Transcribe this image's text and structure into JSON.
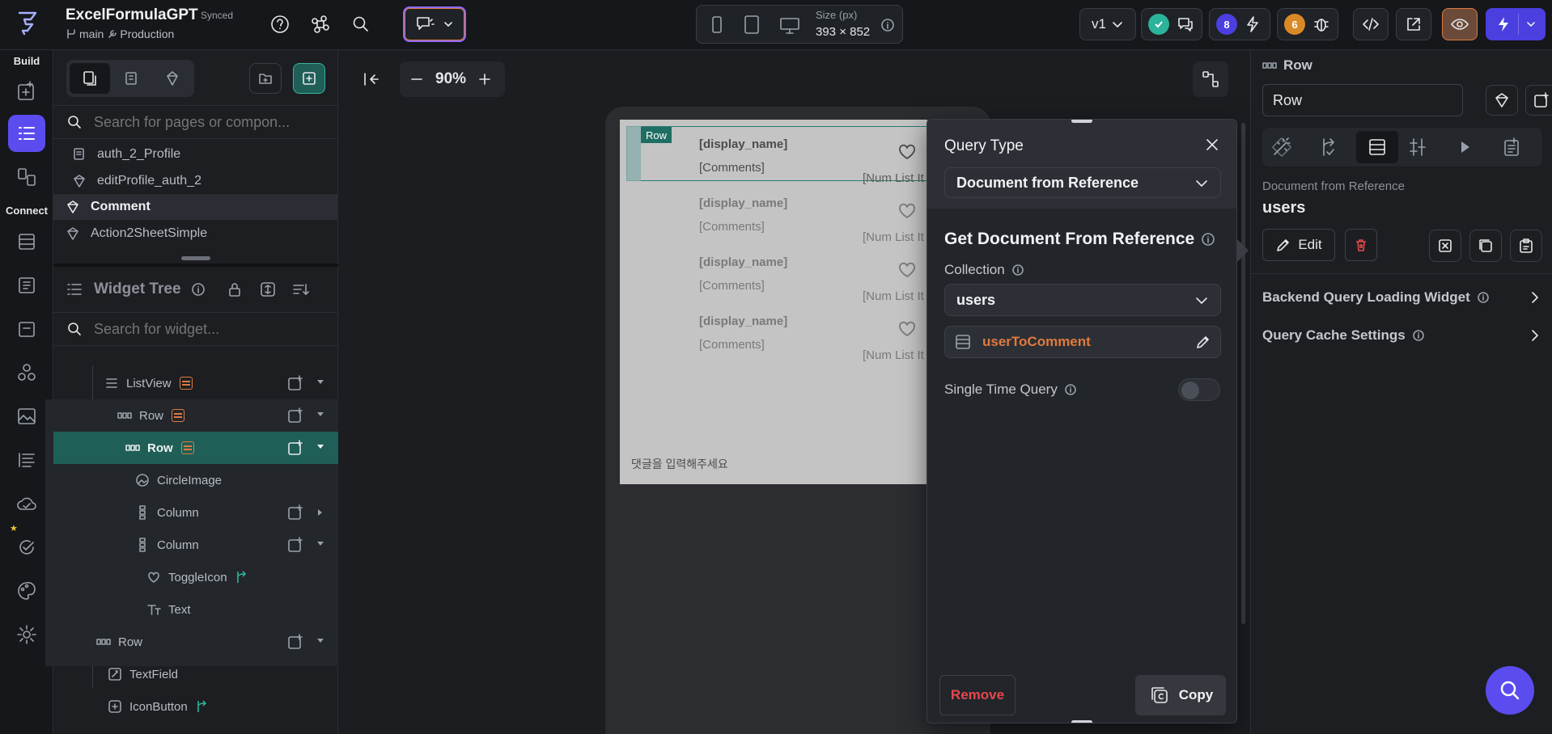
{
  "topbar": {
    "project_name": "ExcelFormulaGPT",
    "sync_status": "Synced",
    "branch": "main",
    "environment": "Production",
    "size_label": "Size (px)",
    "size_value": "393 × 852",
    "version": "v1",
    "badge_count_1": "8",
    "badge_count_2": "6"
  },
  "rail": {
    "build_label": "Build",
    "connect_label": "Connect"
  },
  "leftpanel": {
    "search_pages_placeholder": "Search for pages or compon...",
    "pages": [
      {
        "label": "auth_2_Profile",
        "icon": "page-icon"
      },
      {
        "label": "editProfile_auth_2",
        "icon": "component-icon"
      },
      {
        "label": "Comment",
        "icon": "component-icon",
        "active": true
      },
      {
        "label": "Action2SheetSimple",
        "icon": "component-icon"
      }
    ],
    "widget_tree_title": "Widget Tree",
    "search_widget_placeholder": "Search for widget...",
    "tree": [
      {
        "label": "ListView"
      },
      {
        "label": "Row"
      },
      {
        "label": "Row",
        "selected": true
      },
      {
        "label": "CircleImage"
      },
      {
        "label": "Column"
      },
      {
        "label": "Column"
      },
      {
        "label": "ToggleIcon"
      },
      {
        "label": "Text"
      },
      {
        "label": "Row"
      },
      {
        "label": "TextField"
      },
      {
        "label": "IconButton"
      }
    ]
  },
  "canvas": {
    "zoom": "90%",
    "row_tag": "Row",
    "list_items": [
      {
        "name": "[display_name]",
        "comment": "[Comments]",
        "num": "[Num List It"
      },
      {
        "name": "[display_name]",
        "comment": "[Comments]",
        "num": "[Num List It"
      },
      {
        "name": "[display_name]",
        "comment": "[Comments]",
        "num": "[Num List It"
      },
      {
        "name": "[display_name]",
        "comment": "[Comments]",
        "num": "[Num List It"
      }
    ],
    "input_placeholder": "댓글을 입력해주세요"
  },
  "query_dialog": {
    "title": "Query Type",
    "query_type_value": "Document from Reference",
    "section_title": "Get Document From Reference",
    "collection_label": "Collection",
    "collection_value": "users",
    "reference_value": "userToComment",
    "single_time_label": "Single Time Query",
    "remove_label": "Remove",
    "copy_label": "Copy"
  },
  "rightpanel": {
    "widget_type": "Row",
    "widget_name_value": "Row",
    "backend_source": "Document from Reference",
    "backend_collection": "users",
    "edit_label": "Edit",
    "backend_loading_label": "Backend Query Loading Widget",
    "cache_label": "Query Cache Settings"
  },
  "colors": {
    "accent_purple": "#5b4cf0",
    "selection_teal": "#1f5f57",
    "orange": "#e07a3f",
    "danger_red": "#e5484d",
    "green_check": "#2bb39b"
  }
}
